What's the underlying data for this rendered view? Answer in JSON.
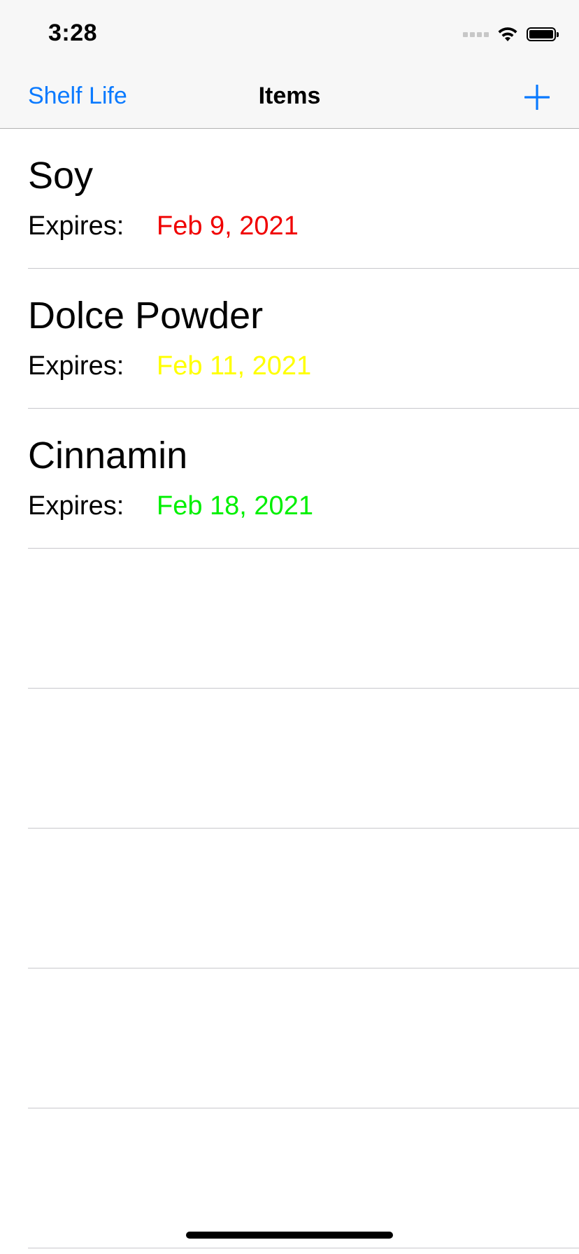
{
  "status_bar": {
    "time": "3:28",
    "icons": [
      "cellular-signal-icon",
      "wifi-icon",
      "battery-icon"
    ]
  },
  "nav": {
    "back_label": "Shelf Life",
    "title": "Items",
    "add_icon": "plus-icon"
  },
  "colors": {
    "accent": "#0a7aff",
    "expired": "#ff0000",
    "warning": "#ffff00",
    "good": "#00ff00"
  },
  "items": [
    {
      "name": "Soy",
      "expires_label": "Expires:",
      "date": "Feb 9, 2021",
      "date_color": "#f00000"
    },
    {
      "name": "Dolce Powder",
      "expires_label": "Expires:",
      "date": "Feb 11, 2021",
      "date_color": "#ffff00"
    },
    {
      "name": "Cinnamin",
      "expires_label": "Expires:",
      "date": "Feb 18, 2021",
      "date_color": "#00f000"
    }
  ]
}
